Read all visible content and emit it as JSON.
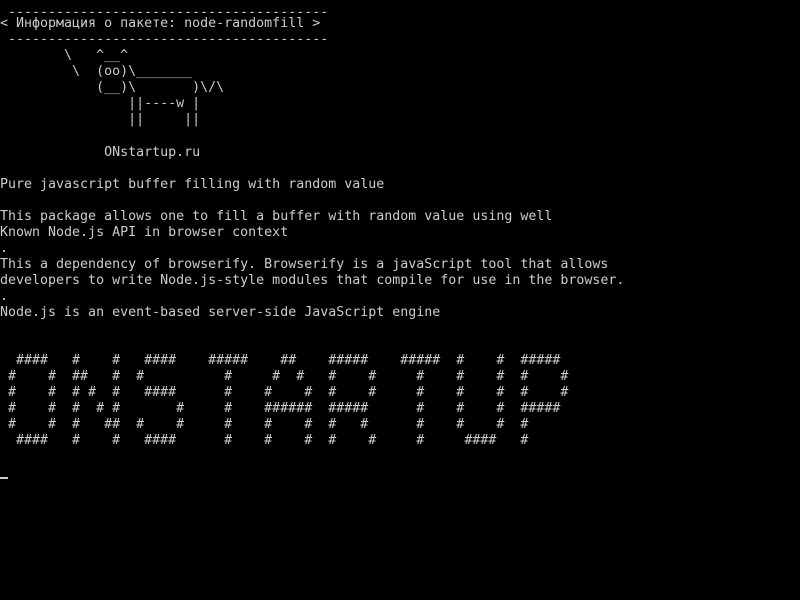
{
  "terminal": {
    "colors": {
      "background": "#000000",
      "foreground": "#cccccc"
    },
    "cowsay": {
      "bubble_top": " ----------------------------------------",
      "bubble_text": "< Информация о пакете: node-randomfill >",
      "bubble_bottom": " ----------------------------------------",
      "cow_line_1": "        \\   ^__^",
      "cow_line_2": "         \\  (oo)\\_______",
      "cow_line_3": "            (__)\\       )\\/\\",
      "cow_line_4": "                ||----w |",
      "cow_line_5": "                ||     ||"
    },
    "site": "             ONstartup.ru",
    "summary": "Pure javascript buffer filling with random value",
    "description": {
      "line_1": "This package allows one to fill a buffer with random value using well",
      "line_2": "Known Node.js API in browser context",
      "sep_1": ".",
      "line_3": "This a dependency of browserify. Browserify is a javaScript tool that allows",
      "line_4": "developers to write Node.js-style modules that compile for use in the browser.",
      "sep_2": ".",
      "line_5": "Node.js is an event-based server-side JavaScript engine"
    },
    "banner": {
      "row_1": "  ####   #    #   ####    #####    ##    #####    #####  #    #  #####",
      "row_2": " #    #  ##   #  #          #     #  #   #    #     #    #    #  #    #",
      "row_3": " #    #  # #  #   ####      #    #    #  #    #     #    #    #  #    #",
      "row_4": " #    #  #  # #       #     #    ######  #####      #    #    #  #####",
      "row_5": " #    #  #   ##  #    #     #    #    #  #   #      #    #    #  #",
      "row_6": "  ####   #    #   ####      #    #    #  #    #     #     ####   #"
    }
  }
}
